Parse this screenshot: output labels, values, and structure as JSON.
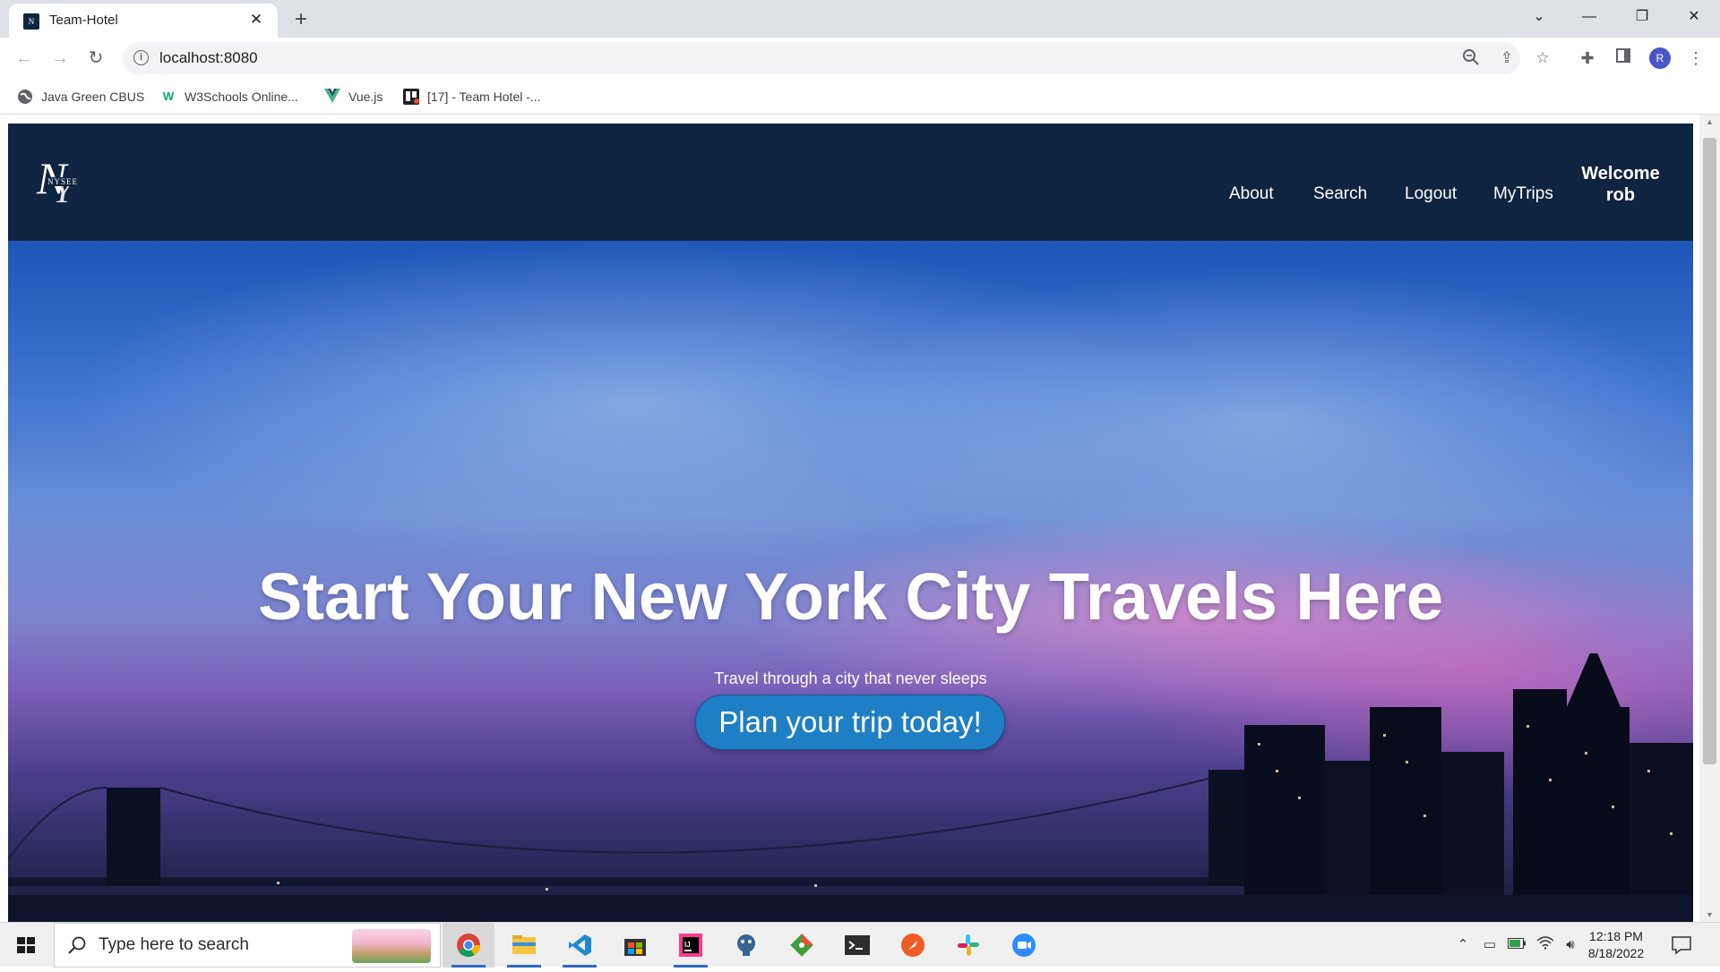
{
  "browser": {
    "tab_title": "Team-Hotel",
    "url": "localhost:8080",
    "profile_initial": "R",
    "bookmarks": [
      {
        "label": "Java Green CBUS",
        "icon": "globe-icon"
      },
      {
        "label": "W3Schools Online...",
        "icon": "w3schools-icon"
      },
      {
        "label": "Vue.js",
        "icon": "vue-icon"
      },
      {
        "label": "[17] - Team Hotel -...",
        "icon": "trello-icon"
      }
    ]
  },
  "site": {
    "logo_text": "NYSEE",
    "nav": {
      "about": "About",
      "search": "Search",
      "logout": "Logout",
      "mytrips": "MyTrips",
      "welcome_line1": "Welcome",
      "welcome_line2": "rob"
    },
    "hero": {
      "title": "Start Your New York City Travels Here",
      "subtitle": "Travel through a city that never sleeps",
      "cta_label": "Plan your trip today!"
    }
  },
  "taskbar": {
    "search_placeholder": "Type here to search",
    "apps": [
      "chrome-icon",
      "file-explorer-icon",
      "vscode-icon",
      "ms-store-icon",
      "intellij-icon",
      "postgres-icon",
      "git-icon",
      "terminal-icon",
      "postman-icon",
      "slack-icon",
      "zoom-icon"
    ],
    "time": "12:18 PM",
    "date": "8/18/2022"
  },
  "colors": {
    "nav_bg": "#0f2440",
    "cta_bg": "#1f7fc4",
    "text_light": "#ffffff"
  }
}
